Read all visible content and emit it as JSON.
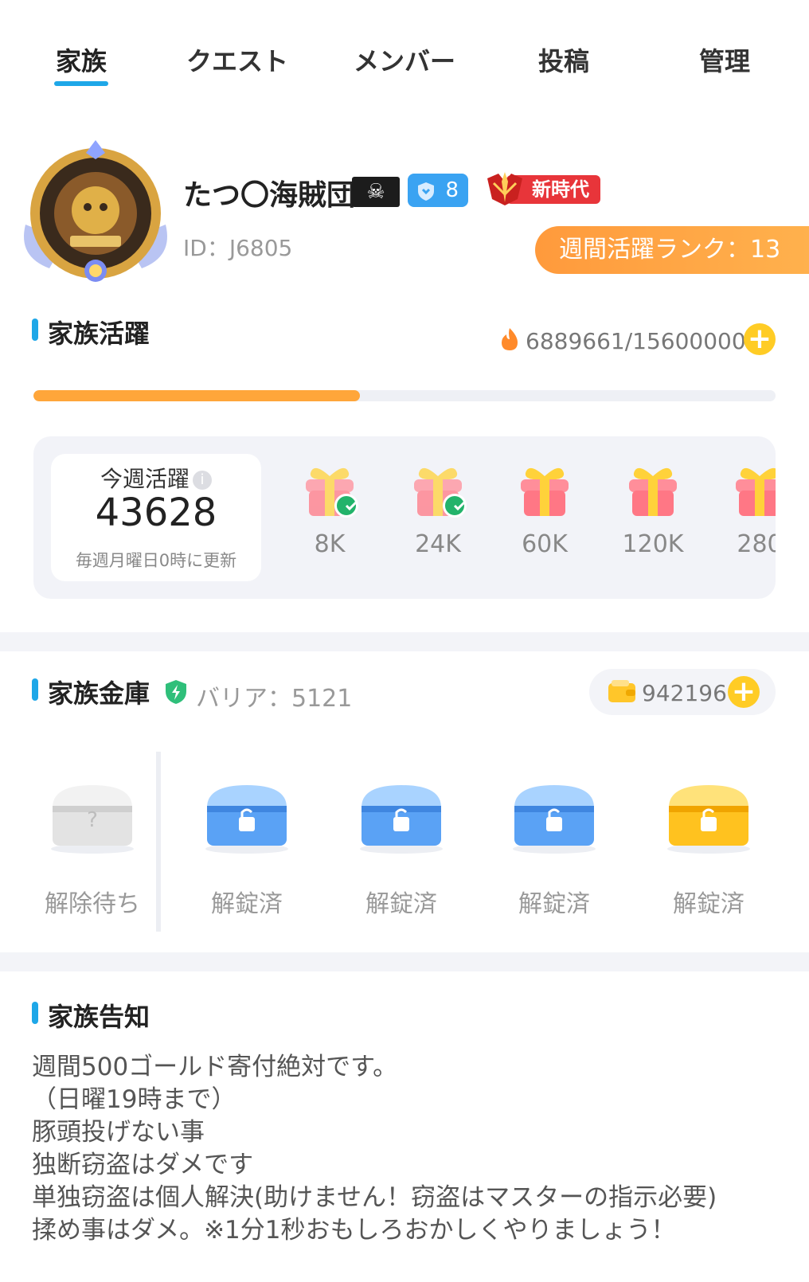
{
  "tabs": [
    {
      "label": "家族",
      "active": true
    },
    {
      "label": "クエスト",
      "active": false
    },
    {
      "label": "メンバー",
      "active": false
    },
    {
      "label": "投稿",
      "active": false
    },
    {
      "label": "管理",
      "active": false
    }
  ],
  "family": {
    "name": "たつ〇海賊団",
    "flag_icon": "pirate-flag-icon",
    "level": "8",
    "era_label": "新時代",
    "id_text": "ID：J6805",
    "weekly_rank_text": "週間活躍ランク：13"
  },
  "activity": {
    "title": "家族活躍",
    "count_text": "6889661/15600000",
    "progress_fraction": 0.44,
    "week_label": "今週活躍",
    "week_value": "43628",
    "week_note": "毎週月曜日0時に更新",
    "rewards": [
      {
        "label": "8K",
        "claimed": true
      },
      {
        "label": "24K",
        "claimed": true
      },
      {
        "label": "60K",
        "claimed": false
      },
      {
        "label": "120K",
        "claimed": false
      },
      {
        "label": "280",
        "claimed": false
      }
    ]
  },
  "vault": {
    "title": "家族金庫",
    "barrier_text": "バリア：5121",
    "gold_amount": "942196",
    "chests": [
      {
        "label": "解除待ち",
        "style": "gray"
      },
      {
        "label": "解錠済",
        "style": "blue"
      },
      {
        "label": "解錠済",
        "style": "blue"
      },
      {
        "label": "解錠済",
        "style": "blue"
      },
      {
        "label": "解錠済",
        "style": "gold"
      }
    ]
  },
  "notice": {
    "title": "家族告知",
    "lines": [
      "週間500ゴールド寄付絶対です。",
      "（日曜19時まで）",
      "豚頭投げない事",
      "独断窃盗はダメです",
      "単独窃盗は個人解決(助けません！窃盗はマスターの指示必要)",
      "揉め事はダメ。※1分1秒おもしろおかしくやりましょう！"
    ]
  },
  "colors": {
    "accent": "#1ea7e8",
    "rank_orange": "#ff9a3c",
    "progress": "#ffa63a",
    "plus_yellow": "#ffcc25",
    "check_green": "#23b36b",
    "era_red": "#e8353a"
  }
}
